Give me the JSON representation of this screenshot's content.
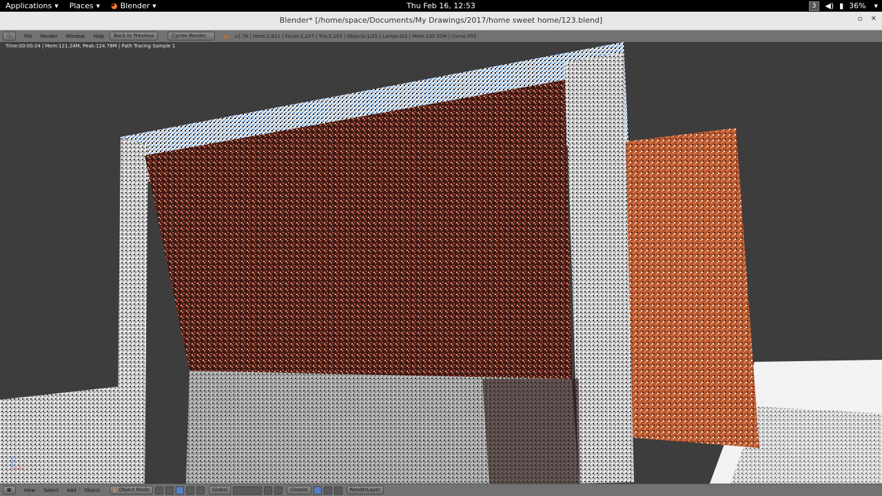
{
  "topbar": {
    "applications": "Applications",
    "places": "Places",
    "app": "Blender",
    "clock": "Thu Feb 16, 12:53",
    "workspace": "3",
    "battery": "36%"
  },
  "window": {
    "title": "Blender* [/home/space/Documents/My Drawings/2017/home sweet home/123.blend]"
  },
  "info_header": {
    "menus": [
      "File",
      "Render",
      "Window",
      "Help"
    ],
    "back_button": "Back to Previous",
    "engine": "Cycles Render",
    "stats": "v2.78 | Verts:2,811 | Faces:2,207 | Tris:5,193 | Objects:1/25 | Lamps:0/1 | Mem:235.02M | Curve.055"
  },
  "viewport": {
    "render_status": "Time:00:00.04 | Mem:121.24M, Peak:124.78M | Path Tracing Sample 1"
  },
  "bottom_header": {
    "menus": [
      "View",
      "Select",
      "Add",
      "Object"
    ],
    "mode": "Object Mode",
    "orientation": "Global",
    "snap": "Closest",
    "render_layer": "RenderLayer"
  },
  "colors": {
    "viewport_bg": "#3d3d3d",
    "header_bg": "#727272",
    "wall_main": "#5a2a22",
    "wall_side": "#c9683f",
    "floor": "#e8e8e8"
  }
}
